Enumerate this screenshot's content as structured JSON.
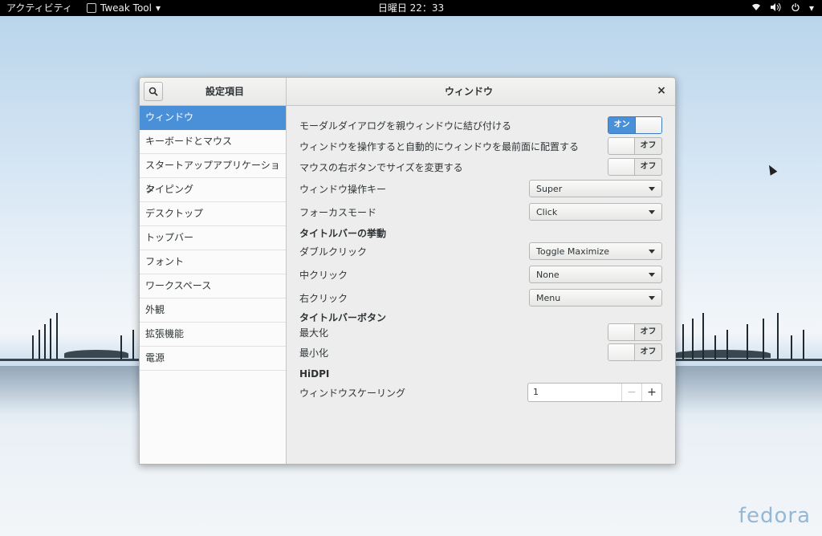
{
  "topbar": {
    "activities": "アクティビティ",
    "app_name": "Tweak Tool",
    "clock": "日曜日 22：33"
  },
  "window": {
    "sidebar_title": "設定項目",
    "main_title": "ウィンドウ",
    "close": "×"
  },
  "sidebar": {
    "items": [
      {
        "label": "ウィンドウ"
      },
      {
        "label": "キーボードとマウス"
      },
      {
        "label": "スタートアップアプリケーション"
      },
      {
        "label": "タイピング"
      },
      {
        "label": "デスクトップ"
      },
      {
        "label": "トップバー"
      },
      {
        "label": "フォント"
      },
      {
        "label": "ワークスペース"
      },
      {
        "label": "外観"
      },
      {
        "label": "拡張機能"
      },
      {
        "label": "電源"
      }
    ]
  },
  "settings": {
    "modal_attach": {
      "label": "モーダルダイアログを親ウィンドウに結び付ける",
      "state": "オン"
    },
    "raise_on_action": {
      "label": "ウィンドウを操作すると自動的にウィンドウを最前面に配置する",
      "state": "オフ"
    },
    "resize_secondary": {
      "label": "マウスの右ボタンでサイズを変更する",
      "state": "オフ"
    },
    "action_key": {
      "label": "ウィンドウ操作キー",
      "value": "Super"
    },
    "focus_mode": {
      "label": "フォーカスモード",
      "value": "Click"
    },
    "titlebar_actions_header": "タイトルバーの挙動",
    "double_click": {
      "label": "ダブルクリック",
      "value": "Toggle Maximize"
    },
    "middle_click": {
      "label": "中クリック",
      "value": "None"
    },
    "right_click": {
      "label": "右クリック",
      "value": "Menu"
    },
    "titlebar_buttons_header": "タイトルバーボタン",
    "maximize": {
      "label": "最大化",
      "state": "オフ"
    },
    "minimize": {
      "label": "最小化",
      "state": "オフ"
    },
    "hidpi_header": "HiDPI",
    "window_scaling": {
      "label": "ウィンドウスケーリング",
      "value": "1",
      "minus": "−",
      "plus": "+"
    }
  },
  "wallpaper": {
    "brand": "fedora"
  }
}
